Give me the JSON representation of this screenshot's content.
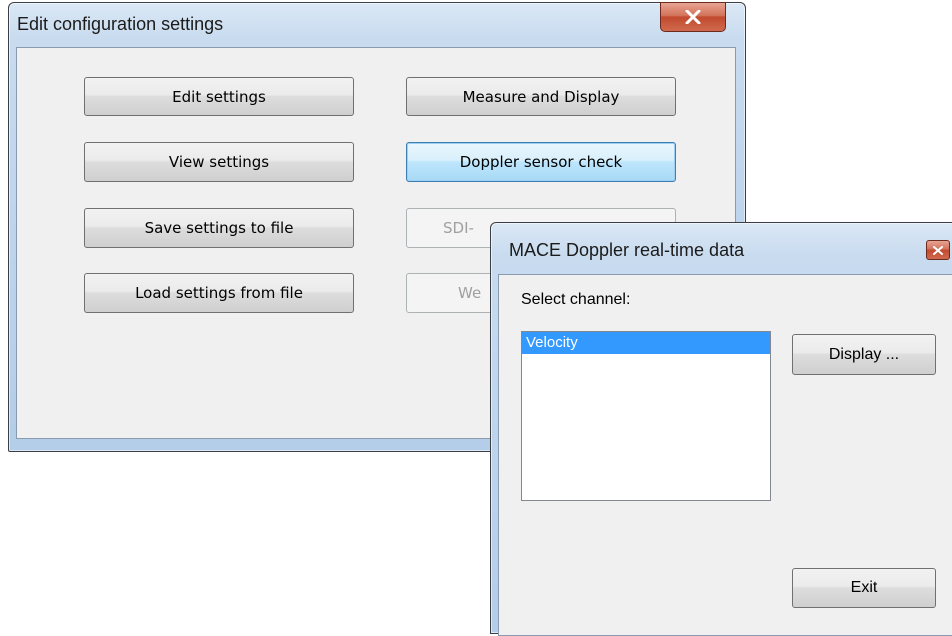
{
  "config_window": {
    "title": "Edit configuration settings",
    "buttons": {
      "edit_settings": "Edit settings",
      "view_settings": "View settings",
      "save_settings": "Save settings to file",
      "load_settings": "Load settings from file",
      "measure_display": "Measure and Display",
      "doppler_check": "Doppler sensor check",
      "sdi_partial": "SDI-",
      "we_partial": "We"
    },
    "close_icon": "close-x-icon"
  },
  "doppler_window": {
    "title": "MACE Doppler real-time data",
    "select_label": "Select channel:",
    "channels": [
      "Velocity"
    ],
    "selected_channel": "Velocity",
    "display_button": "Display ...",
    "exit_button": "Exit",
    "close_icon": "close-x-icon"
  },
  "colors": {
    "close_red": "#c24a2f",
    "selection_blue": "#3399ff",
    "focus_blue": "#3c7fb1"
  }
}
